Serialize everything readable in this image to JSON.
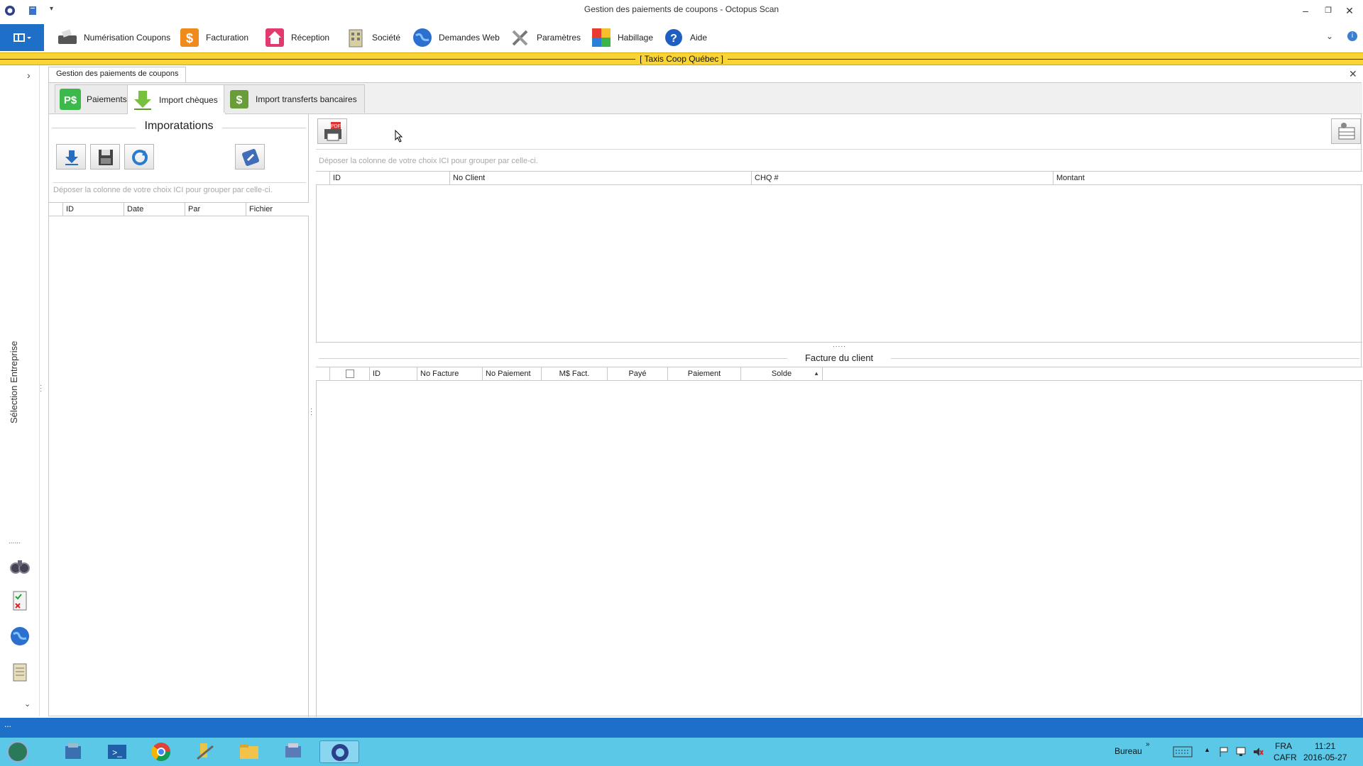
{
  "window": {
    "title": "Gestion des paiements de coupons - Octopus Scan",
    "controls": [
      "minimize",
      "restore",
      "close"
    ]
  },
  "menu": {
    "items": [
      {
        "label": "Numérisation Coupons",
        "icon": "scanner-icon"
      },
      {
        "label": "Facturation",
        "icon": "invoice-icon"
      },
      {
        "label": "Réception",
        "icon": "home-icon"
      },
      {
        "label": "Société",
        "icon": "building-icon"
      },
      {
        "label": "Demandes Web",
        "icon": "globe-icon"
      },
      {
        "label": "Paramètres",
        "icon": "tools-icon"
      },
      {
        "label": "Habillage",
        "icon": "palette-icon"
      },
      {
        "label": "Aide",
        "icon": "help-icon"
      }
    ]
  },
  "banner": {
    "company": "[  Taxis Coop Québec  ]"
  },
  "sidebar": {
    "label": "Sélection Entreprise",
    "dots": "......"
  },
  "document": {
    "tab_label": "Gestion des paiements de coupons"
  },
  "tabs": [
    {
      "label": "Paiements",
      "active": false
    },
    {
      "label": "Import chèques",
      "active": true
    },
    {
      "label": "Import transferts bancaires",
      "active": false
    }
  ],
  "imports": {
    "title": "Imporatations",
    "drop_hint": "Déposer la colonne de votre choix ICI pour grouper par celle-ci.",
    "columns": [
      "ID",
      "Date",
      "Par",
      "Fichier"
    ]
  },
  "cheques": {
    "drop_hint": "Déposer la colonne de votre choix ICI pour grouper par celle-ci.",
    "columns": [
      "ID",
      "No Client",
      "CHQ #",
      "Montant"
    ]
  },
  "invoices": {
    "title": "Facture du client",
    "columns": [
      "ID",
      "No Facture",
      "No Paiement",
      "M$ Fact.",
      "Payé",
      "Paiement",
      "Solde"
    ],
    "sort_indicator": "▲"
  },
  "statusbar": {
    "text": "..."
  },
  "taskbar": {
    "bureau": "Bureau",
    "lang1": "FRA",
    "lang2": "CAFR",
    "time": "11:21",
    "date": "2016-05-27"
  },
  "colors": {
    "accent": "#1e6fc7",
    "banner": "#f9d437",
    "taskbar": "#5bc8e8"
  }
}
